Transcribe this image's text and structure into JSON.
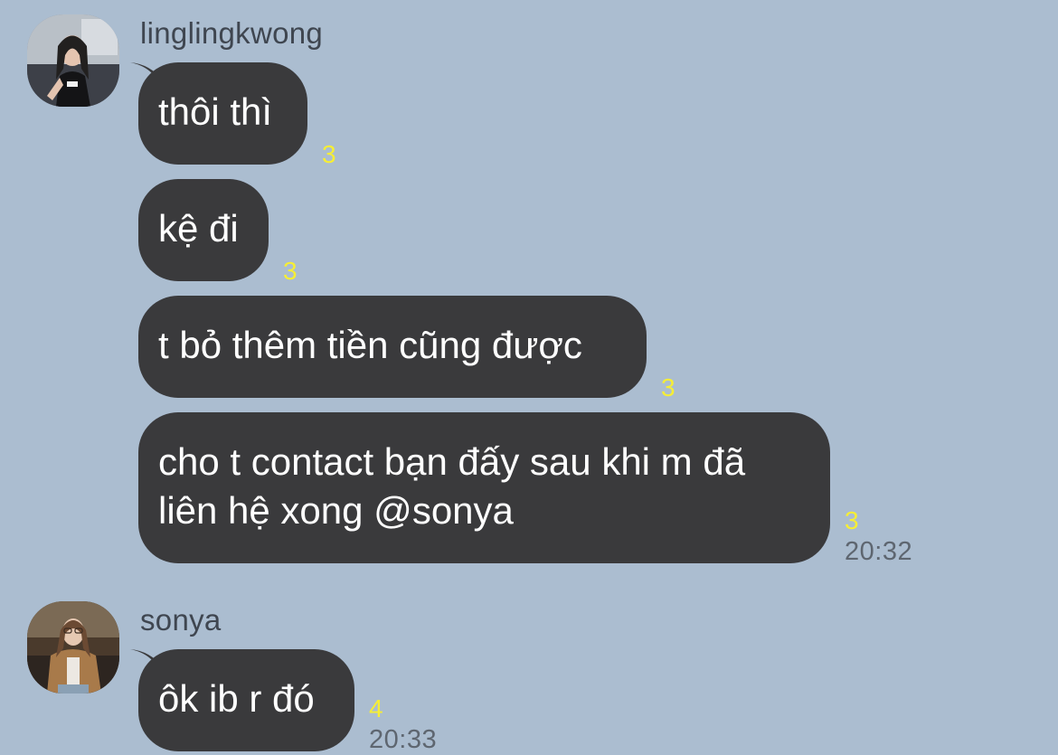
{
  "conversation": {
    "groups": [
      {
        "sender": "linglingkwong",
        "messages": [
          {
            "text": "thôi thì",
            "unread": "3"
          },
          {
            "text": "kệ đi",
            "unread": "3"
          },
          {
            "text": "t bỏ thêm tiền cũng được",
            "unread": "3"
          },
          {
            "text_line1": "cho t contact bạn đấy sau khi m đã",
            "text_line2": "liên hệ xong @sonya",
            "unread": "3",
            "time": "20:32"
          }
        ]
      },
      {
        "sender": "sonya",
        "messages": [
          {
            "text": "ôk ib r đó",
            "unread": "4",
            "time": "20:33"
          }
        ]
      }
    ]
  },
  "colors": {
    "background": "#abbdd0",
    "bubble": "#3a3a3c",
    "bubble_text": "#ffffff",
    "unread_count": "#f6ee35",
    "timestamp": "#5e6670",
    "sender_name": "#3f4650"
  },
  "icons": {
    "avatar_linglingkwong": "profile-photo",
    "avatar_sonya": "profile-photo"
  }
}
